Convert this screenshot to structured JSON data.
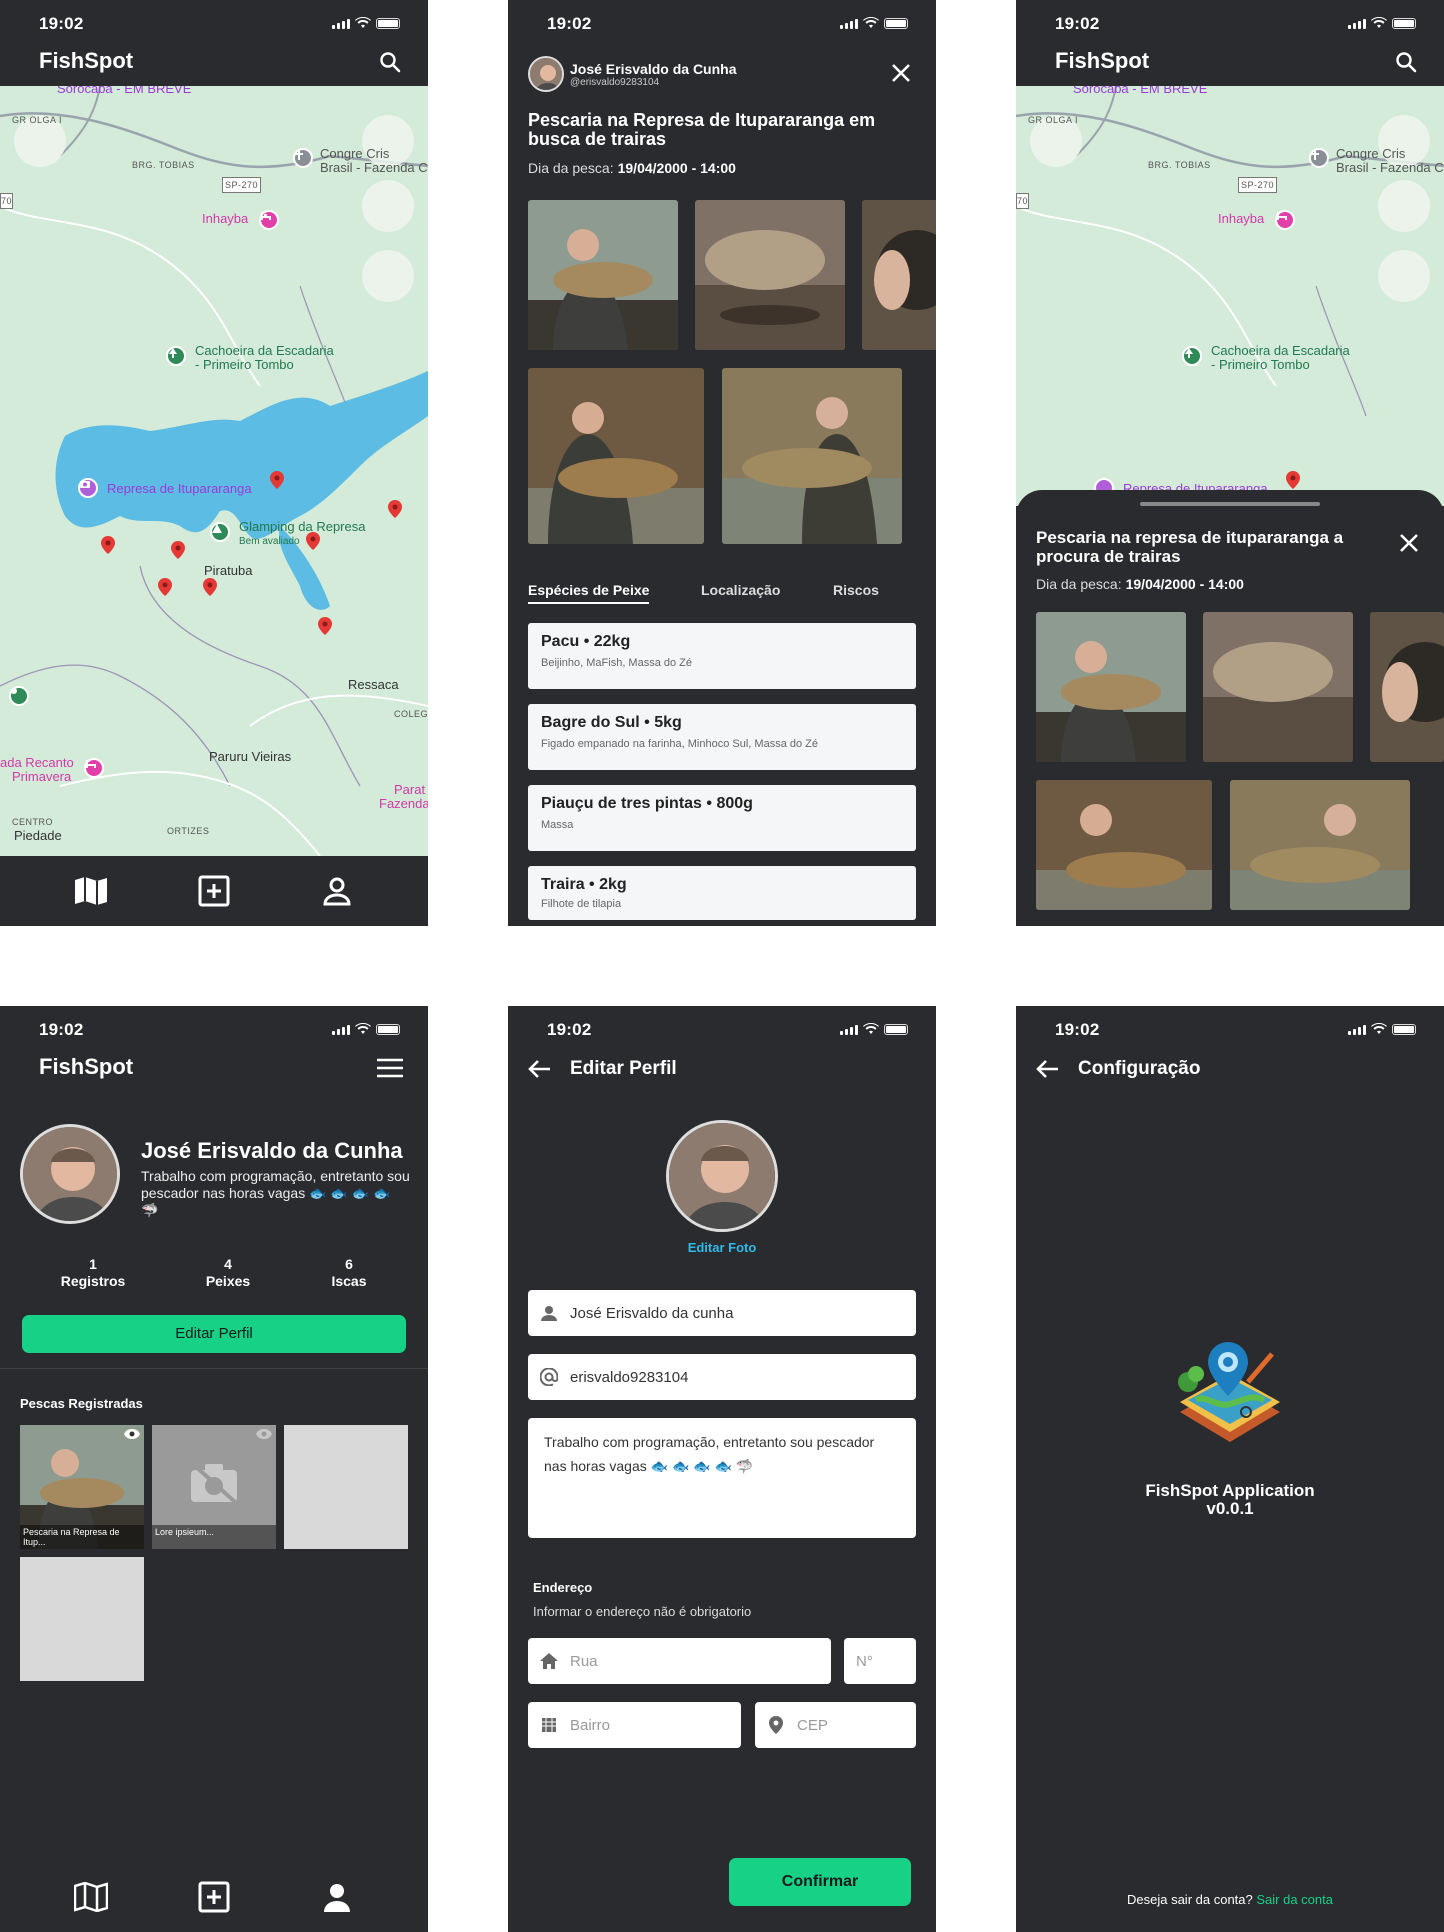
{
  "status": {
    "time": "19:02"
  },
  "app": {
    "name": "FishSpot"
  },
  "map": {
    "labels": {
      "sorocaba": "Sorocaba - EM BREVE",
      "grg_olga": "GR       OLGA I",
      "brg_tobias": "BRG. TOBIAS",
      "sp270": "SP-270",
      "congresso": "Congre    Cris",
      "congresso2": "Brasil - Fazenda C",
      "inhayba": "Inhayba",
      "cachoeira1": "Cachoeira da Escadaria",
      "cachoeira2": "- Primeiro Tombo",
      "represa": "Represa de Itupararanga",
      "glamping1": "Glamping da Represa",
      "glamping2": "Bem avaliado",
      "piratuba": "Piratuba",
      "ressaca": "Ressaca",
      "coleg": "COLEG",
      "recanto1": "ada Recanto",
      "recanto2": "Primavera",
      "paruru": "Paruru Vieiras",
      "parat1": "Parat",
      "parat2": "Fazenda",
      "centro": "CENTRO",
      "piedade": "Piedade",
      "ortizes": "ORTIZES",
      "seventy": "70"
    },
    "colors": {
      "land": "#d3ebd8",
      "water": "#5cbce4",
      "pin": "#e53935"
    }
  },
  "nav": {
    "icons": [
      "map-icon",
      "add-box-icon",
      "person-icon"
    ]
  },
  "post": {
    "author_name": "José Erisvaldo da Cunha",
    "author_handle": "@erisvaldo9283104",
    "title": "Pescaria na Represa de Itupararanga em busca de trairas",
    "date_label": "Dia da pesca:",
    "date_value": "19/04/2000 - 14:00",
    "tabs": [
      "Espécies de Peixe",
      "Localização",
      "Riscos"
    ],
    "species": [
      {
        "name": "Pacu",
        "weight": "22kg",
        "baits": "Beijinho, MaFish, Massa do Zé"
      },
      {
        "name": "Bagre do Sul",
        "weight": "5kg",
        "baits": "Figado empanado na farinha, Minhoco Sul, Massa do Zé"
      },
      {
        "name": "Piauçu de tres pintas",
        "weight": "800g",
        "baits": "Massa"
      },
      {
        "name": "Traira",
        "weight": "2kg",
        "baits": "Filhote de tilapia"
      }
    ]
  },
  "sheet": {
    "title": "Pescaria na represa de itupararanga a procura de trairas",
    "date_label": "Dia da pesca:",
    "date_value": "19/04/2000 - 14:00"
  },
  "profile": {
    "name": "José Erisvaldo da Cunha",
    "bio": "Trabalho com programação, entretanto sou pescador nas horas vagas 🐟 🐟 🐟 🐟 🦈",
    "stats": [
      {
        "value": "1",
        "label": "Registros"
      },
      {
        "value": "4",
        "label": "Peixes"
      },
      {
        "value": "6",
        "label": "Iscas"
      }
    ],
    "edit_button": "Editar Perfil",
    "section_title": "Pescas Registradas",
    "thumbs": [
      {
        "caption": "Pescaria na Represa de Itup..."
      },
      {
        "caption": "Lore ipsieum..."
      }
    ]
  },
  "edit": {
    "title": "Editar Perfil",
    "edit_photo": "Editar Foto",
    "name_value": "José Erisvaldo da cunha",
    "username_value": "erisvaldo9283104",
    "bio_value": "Trabalho com programação, entretanto sou pescador nas horas vagas 🐟 🐟 🐟 🐟 🦈",
    "address_title": "Endereço",
    "address_hint": "Informar o endereço não é obrigatorio",
    "street_ph": "Rua",
    "number_ph": "N°",
    "district_ph": "Bairro",
    "cep_ph": "CEP",
    "confirm": "Confirmar"
  },
  "config": {
    "title": "Configuração",
    "app_name": "FishSpot Application",
    "version": "v0.0.1",
    "logout_question": "Deseja sair da conta?",
    "logout_link": "Sair da conta"
  },
  "accent": "#17d187"
}
